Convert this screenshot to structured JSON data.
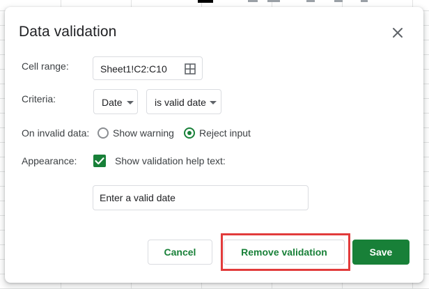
{
  "dialog": {
    "title": "Data validation"
  },
  "cell_range": {
    "label": "Cell range:",
    "value": "Sheet1!C2:C10",
    "icon": "grid-icon"
  },
  "criteria": {
    "label": "Criteria:",
    "type_value": "Date",
    "condition_value": "is valid date"
  },
  "invalid_data": {
    "label": "On invalid data:",
    "options": [
      {
        "label": "Show warning",
        "selected": false
      },
      {
        "label": "Reject input",
        "selected": true
      }
    ]
  },
  "appearance": {
    "label": "Appearance:",
    "checkbox_label": "Show validation help text:",
    "checked": true,
    "help_text_value": "Enter a valid date"
  },
  "buttons": {
    "cancel": "Cancel",
    "remove": "Remove validation",
    "save": "Save"
  },
  "colors": {
    "accent": "#188038",
    "highlight": "#e23b3b"
  }
}
